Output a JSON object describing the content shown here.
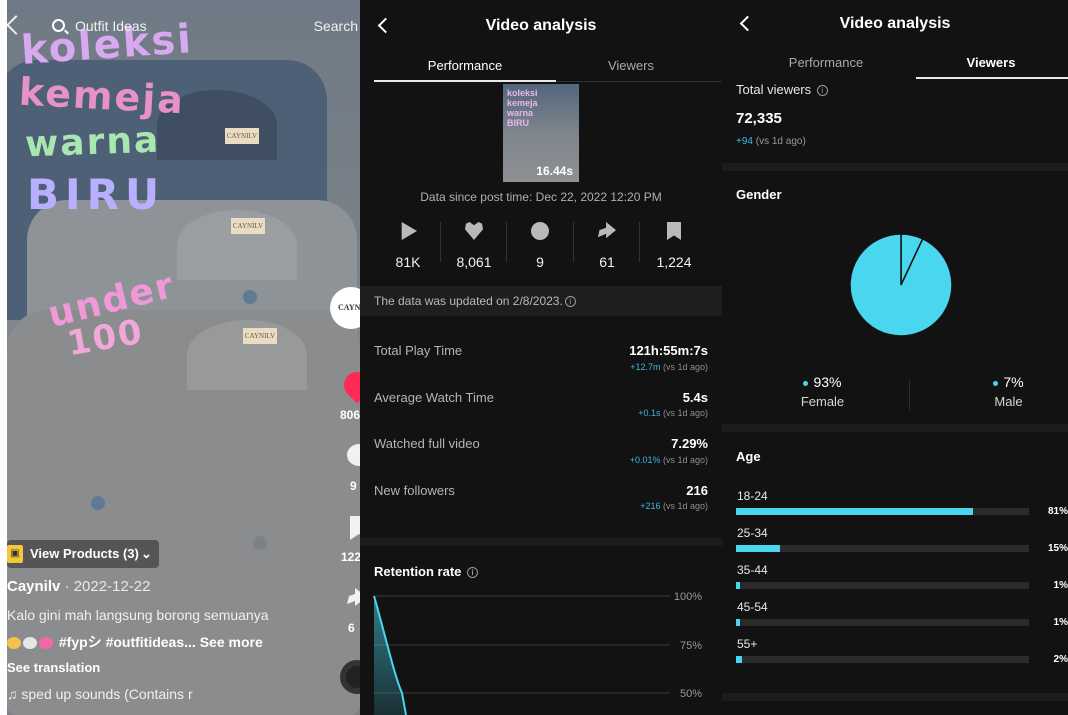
{
  "tiktok": {
    "search_text": "Outfit Ideas",
    "search_button": "Search",
    "overlay_text": [
      "koleksi",
      "kemeja",
      "warna",
      "BIRU",
      "under",
      "100"
    ],
    "shirt_tag": "CAYNILV",
    "avatar_text": "CAYN",
    "likes": "806",
    "comments": "9",
    "bookmarks": "122",
    "shares": "6",
    "view_products": "View Products (3)",
    "author": "Caynilv",
    "date": " · 2022-12-22",
    "caption": "Kalo gini mah langsung borong semuanya",
    "hashtags": "#fypシ #outfitideas...",
    "see_more": "See more",
    "see_translation": "See translation",
    "sound": "sped up sounds (Contains r"
  },
  "performance": {
    "title": "Video analysis",
    "tabs": [
      "Performance",
      "Viewers"
    ],
    "thumb_text": [
      "koleksi",
      "kemeja",
      "warna",
      "BIRU"
    ],
    "duration": "16.44s",
    "data_since": "Data since post time: Dec 22, 2022 12:20 PM",
    "stats": [
      {
        "icon": "play-icon",
        "value": "81K"
      },
      {
        "icon": "heart-icon",
        "value": "8,061"
      },
      {
        "icon": "comment-icon",
        "value": "9"
      },
      {
        "icon": "share-icon",
        "value": "61"
      },
      {
        "icon": "bookmark-icon",
        "value": "1,224"
      }
    ],
    "updated": "The data was updated on 2/8/2023.",
    "metrics": [
      {
        "label": "Total Play Time",
        "value": "121h:55m:7s",
        "delta": "+12.7m",
        "delta_suffix": " (vs 1d ago)"
      },
      {
        "label": "Average Watch Time",
        "value": "5.4s",
        "delta": "+0.1s",
        "delta_suffix": " (vs 1d ago)"
      },
      {
        "label": "Watched full video",
        "value": "7.29%",
        "delta": "+0.01%",
        "delta_suffix": " (vs 1d ago)"
      },
      {
        "label": "New followers",
        "value": "216",
        "delta": "+216",
        "delta_suffix": " (vs 1d ago)"
      }
    ],
    "retention_title": "Retention rate",
    "retention_ticks": [
      "100%",
      "75%",
      "50%"
    ]
  },
  "viewers": {
    "title": "Video analysis",
    "tabs": [
      "Performance",
      "Viewers"
    ],
    "total_label": "Total viewers",
    "total_value": "72,335",
    "total_delta": "+94",
    "total_delta_suffix": " (vs 1d ago)",
    "gender_title": "Gender",
    "gender": [
      {
        "label": "Female",
        "pct": "93%",
        "value": 93
      },
      {
        "label": "Male",
        "pct": "7%",
        "value": 7
      }
    ],
    "age_title": "Age",
    "age": [
      {
        "label": "18-24",
        "pct": "81%",
        "value": 81
      },
      {
        "label": "25-34",
        "pct": "15%",
        "value": 15
      },
      {
        "label": "35-44",
        "pct": "1%",
        "value": 1
      },
      {
        "label": "45-54",
        "pct": "1%",
        "value": 1
      },
      {
        "label": "55+",
        "pct": "2%",
        "value": 2
      }
    ]
  },
  "colors": {
    "accent_cyan": "#49d7ef",
    "delta_blue": "#3fb8e0",
    "tiktok_red": "#ff2b55",
    "panel_bg": "#121212"
  }
}
